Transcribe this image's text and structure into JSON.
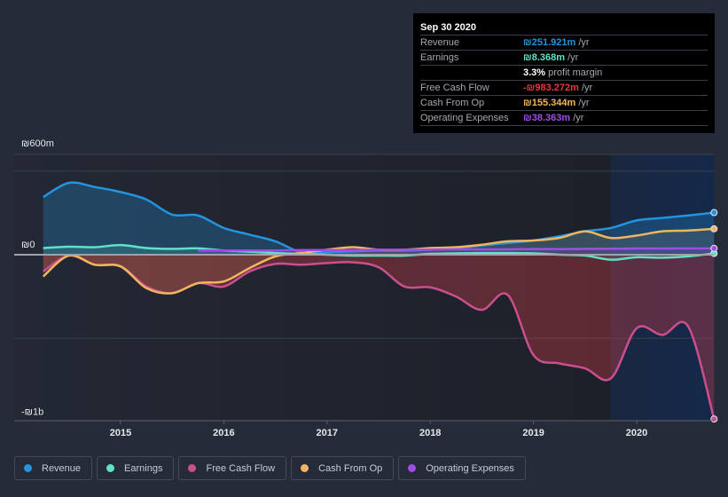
{
  "tooltip": {
    "date": "Sep 30 2020",
    "rows": [
      {
        "label": "Revenue",
        "value": "₪251.921m",
        "unit": " /yr",
        "color": "#2394df"
      },
      {
        "label": "Earnings",
        "value": "₪8.368m",
        "unit": " /yr",
        "color": "#60e1c8"
      },
      {
        "label": "",
        "value": "3.3%",
        "unit": " profit margin",
        "color": "#ffffff"
      },
      {
        "label": "Free Cash Flow",
        "value": "-₪983.272m",
        "unit": " /yr",
        "color": "#e8383d"
      },
      {
        "label": "Cash From Op",
        "value": "₪155.344m",
        "unit": " /yr",
        "color": "#f1b560"
      },
      {
        "label": "Operating Expenses",
        "value": "₪38.363m",
        "unit": " /yr",
        "color": "#a04de8"
      }
    ]
  },
  "legend": [
    {
      "label": "Revenue",
      "color": "#2394df"
    },
    {
      "label": "Earnings",
      "color": "#60e1c8"
    },
    {
      "label": "Free Cash Flow",
      "color": "#c94f8e"
    },
    {
      "label": "Cash From Op",
      "color": "#f1b560"
    },
    {
      "label": "Operating Expenses",
      "color": "#a04de8"
    }
  ],
  "chart_data": {
    "type": "area",
    "title": "",
    "xlabel": "",
    "ylabel": "",
    "y_tick_labels": [
      {
        "label": "₪600m",
        "value": 600
      },
      {
        "label": "₪0",
        "value": 0
      },
      {
        "label": "-₪1b",
        "value": -1000
      }
    ],
    "x_tick_labels": [
      "2015",
      "2016",
      "2017",
      "2018",
      "2019",
      "2020"
    ],
    "xlim": [
      2014.25,
      2020.75
    ],
    "ylim": [
      -1000,
      600
    ],
    "grid": true,
    "highlight_from": 2019.75,
    "legend_position": "bottom",
    "x": [
      2014.25,
      2014.5,
      2014.75,
      2015.0,
      2015.25,
      2015.5,
      2015.75,
      2016.0,
      2016.25,
      2016.5,
      2016.75,
      2017.0,
      2017.25,
      2017.5,
      2017.75,
      2018.0,
      2018.25,
      2018.5,
      2018.75,
      2019.0,
      2019.25,
      2019.5,
      2019.75,
      2020.0,
      2020.25,
      2020.5,
      2020.75
    ],
    "series": [
      {
        "name": "Revenue",
        "color": "#2394df",
        "values": [
          345,
          430,
          405,
          375,
          330,
          240,
          235,
          160,
          120,
          80,
          15,
          15,
          20,
          25,
          25,
          30,
          40,
          55,
          70,
          85,
          110,
          140,
          160,
          205,
          220,
          235,
          252
        ]
      },
      {
        "name": "Earnings",
        "color": "#60e1c8",
        "values": [
          40,
          48,
          45,
          58,
          40,
          35,
          38,
          25,
          18,
          10,
          5,
          0,
          -5,
          -5,
          -5,
          5,
          8,
          10,
          10,
          8,
          0,
          -5,
          -30,
          -15,
          -18,
          -10,
          8
        ]
      },
      {
        "name": "Free Cash Flow",
        "color": "#c94f8e",
        "values": [
          -100,
          -5,
          -60,
          -70,
          -190,
          -230,
          -170,
          -190,
          -100,
          -55,
          -60,
          -50,
          -45,
          -75,
          -190,
          -195,
          -250,
          -330,
          -240,
          -600,
          -650,
          -680,
          -740,
          -440,
          -480,
          -430,
          -983
        ]
      },
      {
        "name": "Cash From Op",
        "color": "#f1b560",
        "values": [
          -130,
          -5,
          -60,
          -70,
          -200,
          -230,
          -170,
          -160,
          -80,
          -10,
          10,
          30,
          45,
          30,
          30,
          40,
          45,
          60,
          80,
          85,
          100,
          140,
          100,
          115,
          140,
          145,
          155
        ]
      },
      {
        "name": "Operating Expenses",
        "color": "#a04de8",
        "values": [
          null,
          null,
          null,
          null,
          null,
          null,
          25,
          25,
          25,
          25,
          28,
          28,
          28,
          30,
          30,
          30,
          32,
          32,
          32,
          34,
          34,
          35,
          36,
          37,
          37,
          38,
          38
        ]
      }
    ]
  }
}
